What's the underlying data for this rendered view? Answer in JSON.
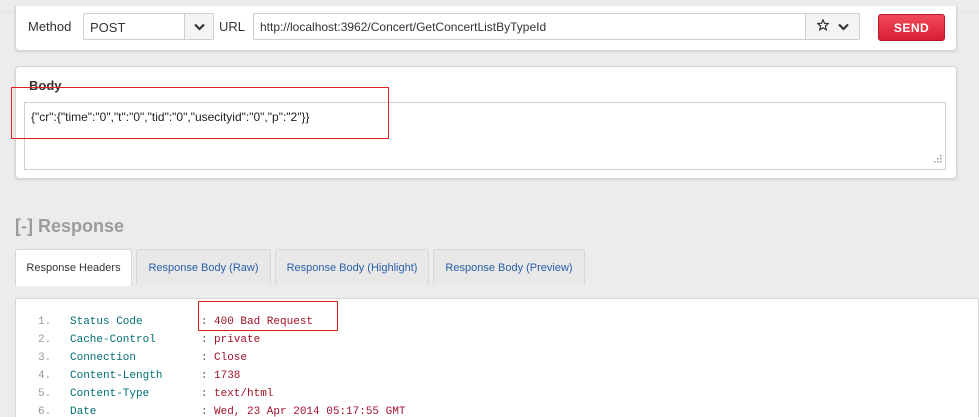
{
  "request": {
    "method_label": "Method",
    "method_value": "POST",
    "url_label": "URL",
    "url_value": "http://localhost:3962/Concert/GetConcertListByTypeId",
    "send_label": "SEND"
  },
  "body": {
    "title": "Body",
    "content": "{\"cr\":{\"time\":\"0\",\"t\":\"0\",\"tid\":\"0\",\"usecityid\":\"0\",\"p\":\"2\"}}"
  },
  "response": {
    "heading": "[-] Response",
    "tabs": [
      {
        "label": "Response Headers",
        "active": true
      },
      {
        "label": "Response Body (Raw)",
        "active": false
      },
      {
        "label": "Response Body (Highlight)",
        "active": false
      },
      {
        "label": "Response Body (Preview)",
        "active": false
      }
    ],
    "headers": [
      {
        "num": "1.",
        "key": "Status Code",
        "value": "400 Bad Request"
      },
      {
        "num": "2.",
        "key": "Cache-Control",
        "value": "private"
      },
      {
        "num": "3.",
        "key": "Connection",
        "value": "Close"
      },
      {
        "num": "4.",
        "key": "Content-Length",
        "value": "1738"
      },
      {
        "num": "5.",
        "key": "Content-Type",
        "value": "text/html"
      },
      {
        "num": "6.",
        "key": "Date",
        "value": "Wed, 23 Apr 2014 05:17:55 GMT"
      }
    ]
  },
  "colors": {
    "send": "#e3293d",
    "highlight_box": "#e02020",
    "header_key": "#006f73",
    "header_value": "#a2112a",
    "tab_link": "#2a5fa8"
  },
  "icons": {
    "method_dropdown": "chevron-down-icon",
    "favorite": "star-icon",
    "url_history": "chevron-down-icon",
    "resize": "resize-grip-icon"
  }
}
